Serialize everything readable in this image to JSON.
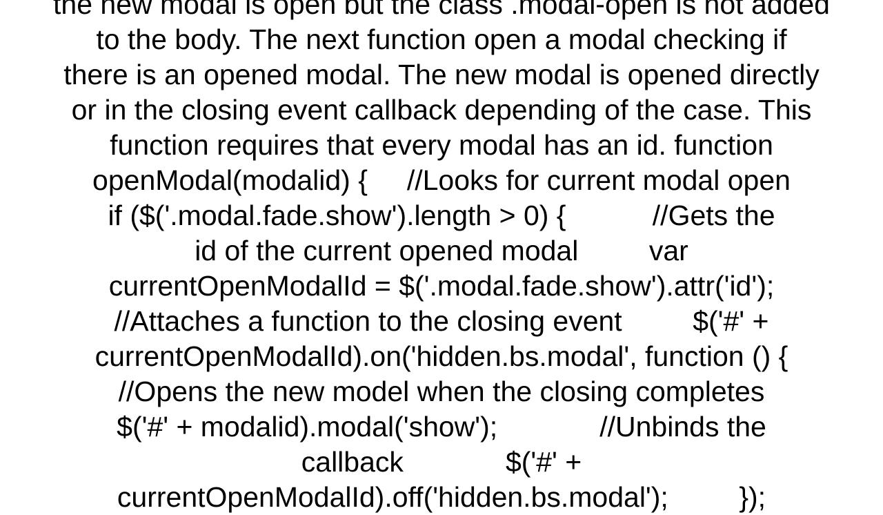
{
  "document": {
    "lines": [
      "the new modal is open but the class .modal-open is not added",
      "to the body. The next function open a modal checking if",
      "there is an opened modal. The new modal is opened directly",
      "or in the closing event callback depending of the case. This",
      "function requires that every modal has an id. function",
      "openModal(modalid) {     //Looks for current modal open",
      "if ($('.modal.fade.show').length > 0) {           //Gets the",
      "id of the current opened modal         var",
      "currentOpenModalId = $('.modal.fade.show').attr('id');",
      "//Attaches a function to the closing event         $('#' +",
      "currentOpenModalId).on('hidden.bs.modal', function () {",
      "//Opens the new model when the closing completes",
      "$('#' + modalid).modal('show');             //Unbinds the",
      "callback             $('#' +",
      "currentOpenModalId).off('hidden.bs.modal');         });"
    ]
  }
}
